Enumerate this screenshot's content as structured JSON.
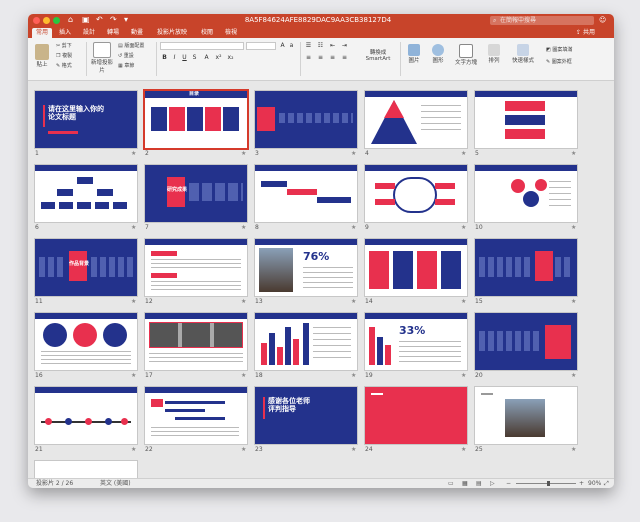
{
  "window": {
    "doc_title": "8A5F84624AFE8829DAC9AA3CB38127D4",
    "search_placeholder": "在簡報中搜尋",
    "share_label": "共用"
  },
  "tabs": [
    "常用",
    "插入",
    "設計",
    "轉場",
    "動畫",
    "投影片放映",
    "校閱",
    "檢視"
  ],
  "ribbon": {
    "paste": "貼上",
    "cut": "剪下",
    "copy": "複製",
    "format": "格式",
    "new_slide": "新增投影片",
    "layout": "版面配置",
    "reset": "重設",
    "section": "章節",
    "convert_smartart": "轉換成SmartArt",
    "picture": "圖片",
    "shape": "圖形",
    "textbox": "文字方塊",
    "arrange": "排列",
    "quick_styles": "快速樣式",
    "shape_fill": "圖案填滿",
    "shape_outline": "圖案外框"
  },
  "slides": [
    {
      "num": "1",
      "title": "请在这里输入你的论文标题"
    },
    {
      "num": "2",
      "title": "目录"
    },
    {
      "num": "3",
      "title": ""
    },
    {
      "num": "4",
      "title": ""
    },
    {
      "num": "5",
      "title": ""
    },
    {
      "num": "6",
      "title": ""
    },
    {
      "num": "7",
      "title": "研究成果"
    },
    {
      "num": "8",
      "title": ""
    },
    {
      "num": "9",
      "title": ""
    },
    {
      "num": "10",
      "title": ""
    },
    {
      "num": "11",
      "title": "作品背景"
    },
    {
      "num": "12",
      "title": ""
    },
    {
      "num": "13",
      "title": "76%"
    },
    {
      "num": "14",
      "title": ""
    },
    {
      "num": "15",
      "title": ""
    },
    {
      "num": "16",
      "title": ""
    },
    {
      "num": "17",
      "title": ""
    },
    {
      "num": "18",
      "title": ""
    },
    {
      "num": "19",
      "title": "33%"
    },
    {
      "num": "20",
      "title": ""
    },
    {
      "num": "21",
      "title": ""
    },
    {
      "num": "22",
      "title": ""
    },
    {
      "num": "23",
      "title": "感谢各位老师评判指导"
    },
    {
      "num": "24",
      "title": ""
    },
    {
      "num": "25",
      "title": ""
    }
  ],
  "status": {
    "slide_pos": "投影片 2 / 26",
    "language": "英文 (美國)",
    "zoom": "90%"
  },
  "colors": {
    "navy": "#23328c",
    "accent": "#e8304e",
    "title_bar": "#c8442a"
  }
}
